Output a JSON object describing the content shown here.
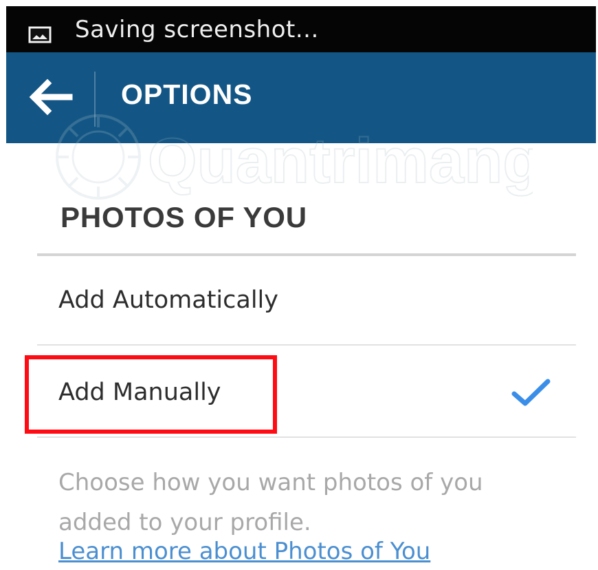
{
  "status_bar": {
    "icon": "image-icon",
    "text": "Saving screenshot..."
  },
  "action_bar": {
    "back_icon": "arrow-left-icon",
    "title": "OPTIONS",
    "background": "#135685"
  },
  "watermark": {
    "text": "Quantrimang"
  },
  "section": {
    "title": "PHOTOS OF YOU"
  },
  "options": [
    {
      "label": "Add Automatically",
      "selected": false
    },
    {
      "label": "Add Manually",
      "selected": true
    }
  ],
  "selection_icon": "checkmark-icon",
  "help": {
    "text": "Choose how you want photos of you added to your profile.",
    "link": "Learn more about Photos of You"
  },
  "colors": {
    "accent": "#3b8ee8",
    "highlight": "#ff0b14",
    "link": "#4b8fd1"
  }
}
